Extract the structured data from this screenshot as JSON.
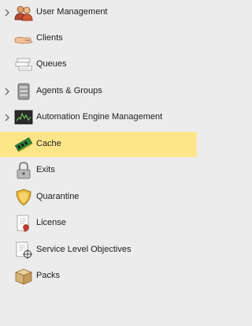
{
  "nav": {
    "items": [
      {
        "label": "User Management",
        "icon": "users-icon",
        "expandable": true,
        "selected": false
      },
      {
        "label": "Clients",
        "icon": "hand-icon",
        "expandable": false,
        "selected": false
      },
      {
        "label": "Queues",
        "icon": "queues-icon",
        "expandable": false,
        "selected": false
      },
      {
        "label": "Agents & Groups",
        "icon": "server-icon",
        "expandable": true,
        "selected": false
      },
      {
        "label": "Automation Engine Management",
        "icon": "monitor-chart-icon",
        "expandable": true,
        "selected": false
      },
      {
        "label": "Cache",
        "icon": "memory-chip-icon",
        "expandable": false,
        "selected": true
      },
      {
        "label": "Exits",
        "icon": "lock-icon",
        "expandable": false,
        "selected": false
      },
      {
        "label": "Quarantine",
        "icon": "shield-icon",
        "expandable": false,
        "selected": false
      },
      {
        "label": "License",
        "icon": "certificate-icon",
        "expandable": false,
        "selected": false
      },
      {
        "label": "Service Level Objectives",
        "icon": "document-target-icon",
        "expandable": false,
        "selected": false
      },
      {
        "label": "Packs",
        "icon": "box-icon",
        "expandable": false,
        "selected": false
      }
    ],
    "selected_color": "#fde68a"
  }
}
